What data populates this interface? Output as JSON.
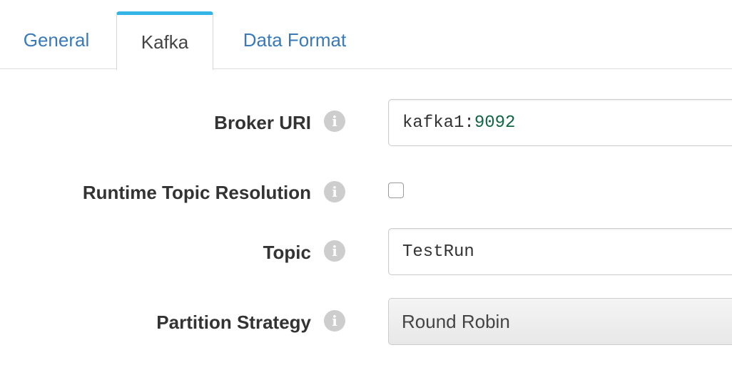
{
  "tabs": [
    {
      "label": "General"
    },
    {
      "label": "Kafka"
    },
    {
      "label": "Data Format"
    }
  ],
  "active_tab": "Kafka",
  "form": {
    "broker_uri": {
      "label": "Broker URI",
      "host": "kafka1:",
      "port": "9092"
    },
    "runtime_topic_resolution": {
      "label": "Runtime Topic Resolution",
      "checked": false
    },
    "topic": {
      "label": "Topic",
      "value": "TestRun"
    },
    "partition_strategy": {
      "label": "Partition Strategy",
      "value": "Round Robin"
    }
  },
  "colors": {
    "accent": "#35b5e5",
    "link": "#3a7ab8",
    "info_icon": "#cdcdcd"
  },
  "icons": {
    "info": "info-circle-icon"
  }
}
